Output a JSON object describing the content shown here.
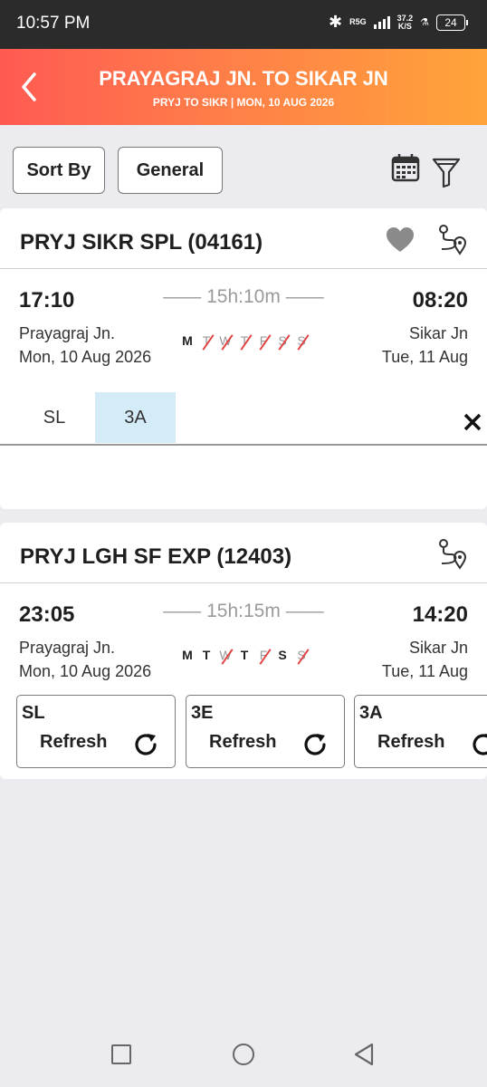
{
  "status_bar": {
    "time": "10:57 PM",
    "network": "R5G",
    "speed_value": "37.2",
    "speed_unit": "K/S",
    "battery": "24"
  },
  "header": {
    "title": "PRAYAGRAJ JN. TO SIKAR JN",
    "subtitle": "PRYJ TO SIKR | MON, 10 AUG  2026"
  },
  "controls": {
    "sort_label": "Sort By",
    "quota_label": "General"
  },
  "trains": [
    {
      "name": "PRYJ SIKR SPL (04161)",
      "departure_time": "17:10",
      "arrival_time": "08:20",
      "duration": "15h:10m",
      "from_station": "Prayagraj Jn.",
      "from_date": "Mon, 10 Aug  2026",
      "to_station": "Sikar Jn",
      "to_date": "Tue, 11 Aug",
      "days": [
        {
          "d": "M",
          "runs": true
        },
        {
          "d": "T",
          "runs": false
        },
        {
          "d": "W",
          "runs": false
        },
        {
          "d": "T",
          "runs": false
        },
        {
          "d": "F",
          "runs": false
        },
        {
          "d": "S",
          "runs": false
        },
        {
          "d": "S",
          "runs": false
        }
      ],
      "classes": [
        "SL",
        "3A"
      ],
      "selected_class": "3A",
      "close_label": "X"
    },
    {
      "name": "PRYJ LGH SF EXP (12403)",
      "departure_time": "23:05",
      "arrival_time": "14:20",
      "duration": "15h:15m",
      "from_station": "Prayagraj Jn.",
      "from_date": "Mon, 10 Aug  2026",
      "to_station": "Sikar Jn",
      "to_date": "Tue, 11 Aug",
      "days": [
        {
          "d": "M",
          "runs": true
        },
        {
          "d": "T",
          "runs": true
        },
        {
          "d": "W",
          "runs": false
        },
        {
          "d": "T",
          "runs": true
        },
        {
          "d": "F",
          "runs": false
        },
        {
          "d": "S",
          "runs": true
        },
        {
          "d": "S",
          "runs": false
        }
      ],
      "class_boxes": [
        {
          "cls": "SL",
          "action": "Refresh"
        },
        {
          "cls": "3E",
          "action": "Refresh"
        },
        {
          "cls": "3A",
          "action": "Refresh"
        }
      ]
    }
  ],
  "colors": {
    "header_start": "#ff5a52",
    "header_end": "#ffa43a",
    "selected_class_bg": "#d3ecf8",
    "off_day_strike": "#e04444"
  },
  "icons": [
    "back-arrow-icon",
    "calendar-icon",
    "filter-icon",
    "heart-icon",
    "route-icon",
    "close-icon",
    "refresh-icon"
  ]
}
